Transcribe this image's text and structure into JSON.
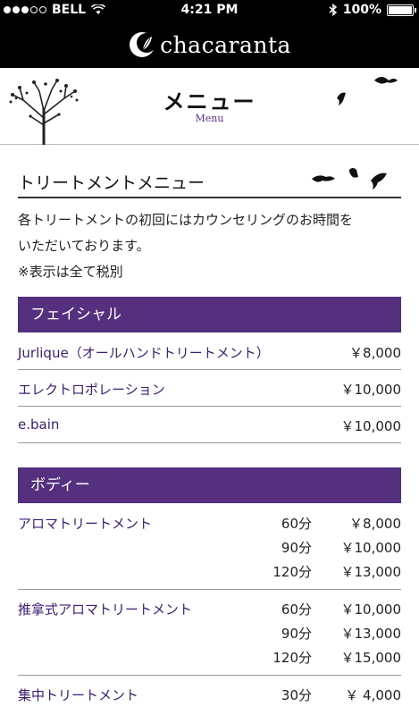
{
  "status_bar": {
    "carrier": "BELL",
    "time": "4:21 PM",
    "battery": "100%"
  },
  "brand": {
    "name": "chacaranta"
  },
  "page_header": {
    "title": "メニュー",
    "subtitle": "Menu"
  },
  "section": {
    "title": "トリートメントメニュー",
    "intro_lines": [
      "各トリートメントの初回にはカウンセリングのお時間を",
      "いただいております。",
      "※表示は全て税別"
    ]
  },
  "facial": {
    "category": "フェイシャル",
    "items": [
      {
        "name": "Jurlique（オールハンドトリートメント）",
        "price": "￥8,000"
      },
      {
        "name": "エレクトロポレーション",
        "price": "￥10,000"
      },
      {
        "name": "e.bain",
        "price": "￥10,000"
      }
    ]
  },
  "body": {
    "category": "ボディー",
    "items": [
      {
        "name": "アロマトリートメント",
        "options": [
          {
            "duration": "60分",
            "price": "￥8,000"
          },
          {
            "duration": "90分",
            "price": "￥10,000"
          },
          {
            "duration": "120分",
            "price": "￥13,000"
          }
        ]
      },
      {
        "name": "推拿式アロマトリートメント",
        "options": [
          {
            "duration": "60分",
            "price": "￥10,000"
          },
          {
            "duration": "90分",
            "price": "￥13,000"
          },
          {
            "duration": "120分",
            "price": "￥15,000"
          }
        ]
      },
      {
        "name": "集中トリートメント",
        "options": [
          {
            "duration": "30分",
            "price": "￥ 4,000"
          }
        ]
      }
    ]
  },
  "colors": {
    "accent": "#54307e",
    "link": "#3d1d72",
    "bar": "#000000"
  }
}
